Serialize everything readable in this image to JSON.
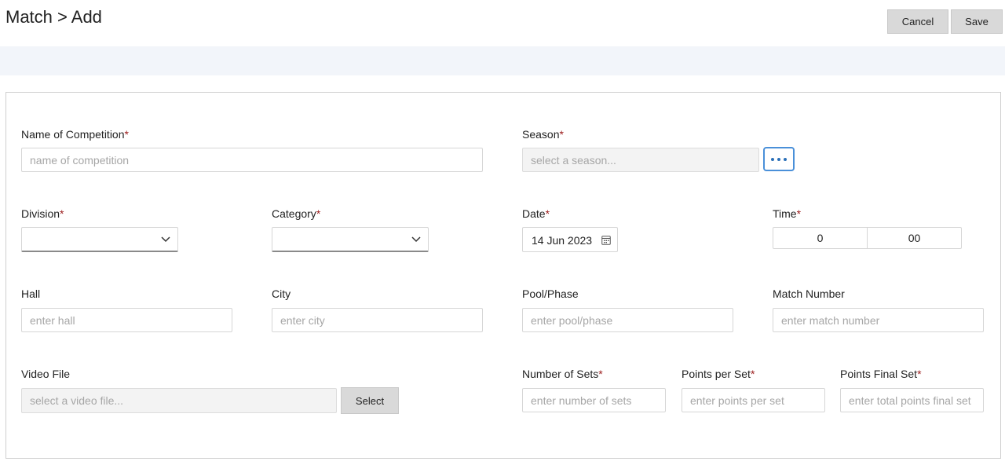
{
  "header": {
    "title": "Match > Add",
    "cancel_label": "Cancel",
    "save_label": "Save"
  },
  "form": {
    "competition": {
      "label": "Name of Competition",
      "required_mark": "*",
      "placeholder": "name of competition",
      "value": ""
    },
    "season": {
      "label": "Season",
      "required_mark": "*",
      "placeholder": "select a season...",
      "value": "",
      "picker_icon": "ellipsis-icon"
    },
    "division": {
      "label": "Division",
      "required_mark": "*",
      "selected": "",
      "icon": "chevron-down-icon"
    },
    "category": {
      "label": "Category",
      "required_mark": "*",
      "selected": "",
      "icon": "chevron-down-icon"
    },
    "date": {
      "label": "Date",
      "required_mark": "*",
      "value": "14 Jun 2023",
      "icon": "calendar-icon"
    },
    "time": {
      "label": "Time",
      "required_mark": "*",
      "hours": "0",
      "minutes": "00"
    },
    "hall": {
      "label": "Hall",
      "placeholder": "enter hall",
      "value": ""
    },
    "city": {
      "label": "City",
      "placeholder": "enter city",
      "value": ""
    },
    "pool_phase": {
      "label": "Pool/Phase",
      "placeholder": "enter pool/phase",
      "value": ""
    },
    "match_number": {
      "label": "Match Number",
      "placeholder": "enter match number",
      "value": ""
    },
    "video_file": {
      "label": "Video File",
      "placeholder": "select a video file...",
      "value": "",
      "button_label": "Select"
    },
    "number_of_sets": {
      "label": "Number of Sets",
      "required_mark": "*",
      "placeholder": "enter number of sets",
      "value": ""
    },
    "points_per_set": {
      "label": "Points per Set",
      "required_mark": "*",
      "placeholder": "enter points per set",
      "value": ""
    },
    "points_final_set": {
      "label": "Points Final Set",
      "required_mark": "*",
      "placeholder": "enter total points final set",
      "value": ""
    }
  },
  "colors": {
    "required": "#9b1c1c",
    "accent": "#4a90d9",
    "band": "#f2f5fa"
  }
}
